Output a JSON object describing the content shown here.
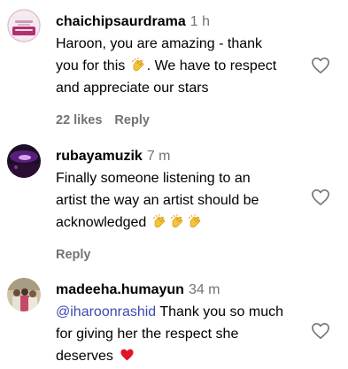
{
  "comments": [
    {
      "username": "chaichipsaurdrama",
      "time": "1 h",
      "text_lines": [
        "Haroon, you are amazing - thank",
        "you for this",
        ". We have to respect",
        "and appreciate our stars"
      ],
      "likes": "22 likes",
      "reply": "Reply",
      "avatar_icon": "avatar-pink-logo",
      "emoji": "clapping-hands"
    },
    {
      "username": "rubayamuzik",
      "time": "7 m",
      "text_lines": [
        "Finally someone listening to an",
        "artist the way an artist should be",
        "acknowledged"
      ],
      "reply": "Reply",
      "avatar_icon": "avatar-concert-purple",
      "emoji": "clapping-hands"
    },
    {
      "username": "madeeha.humayun",
      "time": "34 m",
      "mention": "@iharoonrashid",
      "text_lines": [
        " Thank you so much",
        "for giving her the respect she",
        "deserves"
      ],
      "avatar_icon": "avatar-group-photo",
      "emoji": "red-heart"
    }
  ],
  "colors": {
    "text": "#000000",
    "muted": "#737373",
    "mention": "#3b4bb0",
    "heart": "#e0152b",
    "clap": "#f6c33a"
  },
  "icons": {
    "like": "heart-outline-icon"
  }
}
